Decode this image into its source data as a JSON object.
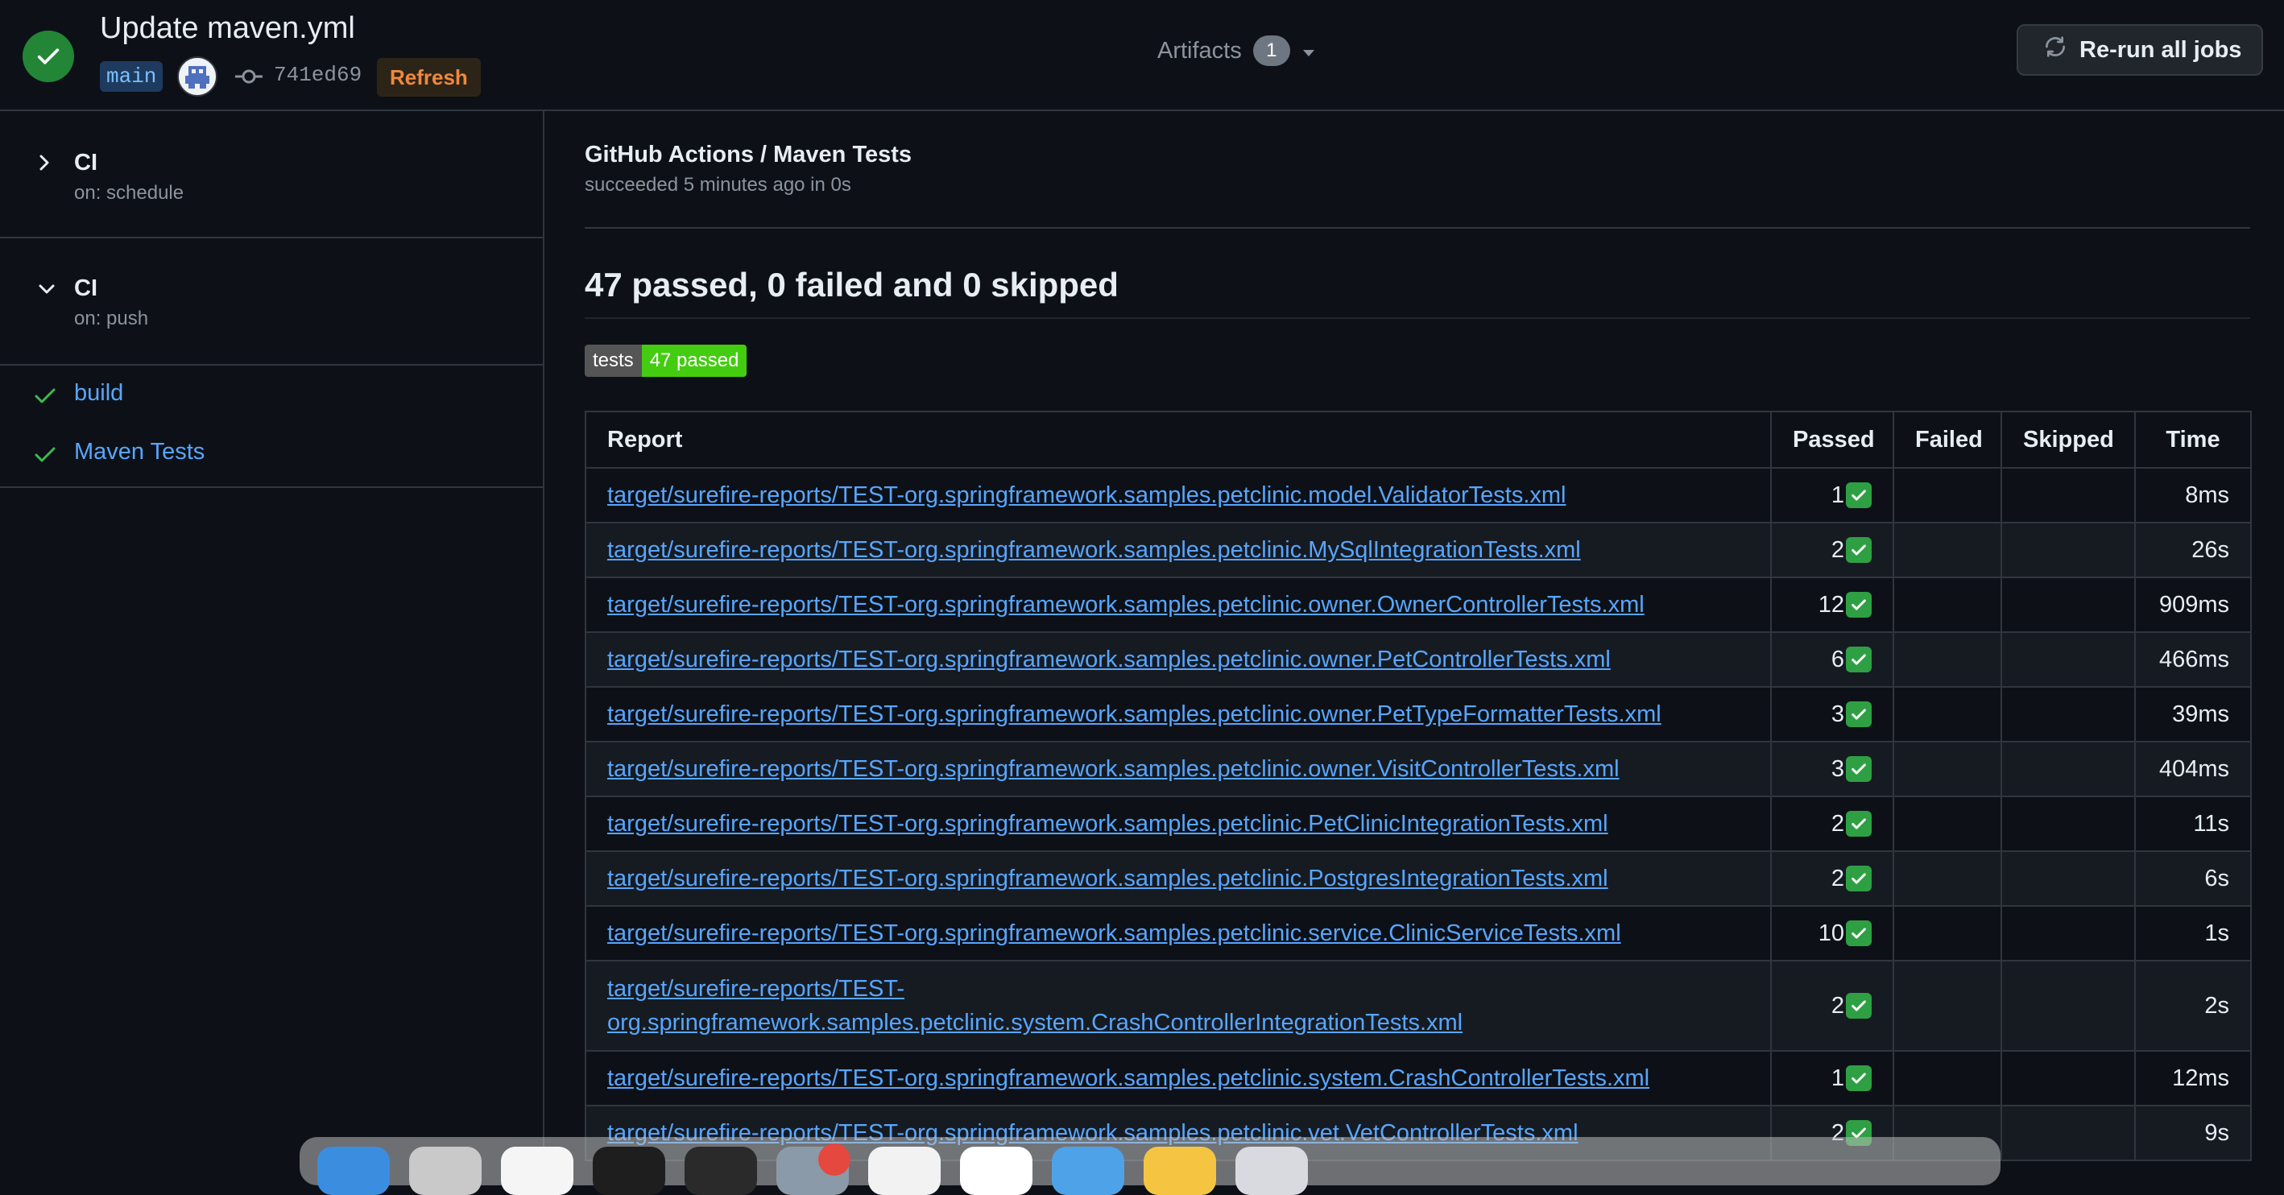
{
  "header": {
    "title": "Update maven.yml",
    "branch": "main",
    "commit_sha": "741ed69",
    "refresh_label": "Refresh",
    "artifacts_label": "Artifacts",
    "artifacts_count": "1",
    "rerun_label": "Re-run all jobs",
    "status": "success"
  },
  "sidebar": {
    "workflows": [
      {
        "name": "CI",
        "trigger": "on: schedule",
        "expanded": false
      },
      {
        "name": "CI",
        "trigger": "on: push",
        "expanded": true
      }
    ],
    "jobs": [
      {
        "name": "build",
        "status": "success"
      },
      {
        "name": "Maven Tests",
        "status": "success"
      }
    ]
  },
  "main": {
    "title": "GitHub Actions / Maven Tests",
    "subtitle": "succeeded 5 minutes ago in 0s",
    "summary": "47 passed, 0 failed and 0 skipped",
    "badge_left": "tests",
    "badge_right": "47 passed",
    "table": {
      "headers": [
        "Report",
        "Passed",
        "Failed",
        "Skipped",
        "Time"
      ],
      "rows": [
        {
          "report": "target/surefire-reports/TEST-org.springframework.samples.petclinic.model.ValidatorTests.xml",
          "passed": "1",
          "failed": "",
          "skipped": "",
          "time": "8ms"
        },
        {
          "report": "target/surefire-reports/TEST-org.springframework.samples.petclinic.MySqlIntegrationTests.xml",
          "passed": "2",
          "failed": "",
          "skipped": "",
          "time": "26s"
        },
        {
          "report": "target/surefire-reports/TEST-org.springframework.samples.petclinic.owner.OwnerControllerTests.xml",
          "passed": "12",
          "failed": "",
          "skipped": "",
          "time": "909ms"
        },
        {
          "report": "target/surefire-reports/TEST-org.springframework.samples.petclinic.owner.PetControllerTests.xml",
          "passed": "6",
          "failed": "",
          "skipped": "",
          "time": "466ms"
        },
        {
          "report": "target/surefire-reports/TEST-org.springframework.samples.petclinic.owner.PetTypeFormatterTests.xml",
          "passed": "3",
          "failed": "",
          "skipped": "",
          "time": "39ms"
        },
        {
          "report": "target/surefire-reports/TEST-org.springframework.samples.petclinic.owner.VisitControllerTests.xml",
          "passed": "3",
          "failed": "",
          "skipped": "",
          "time": "404ms"
        },
        {
          "report": "target/surefire-reports/TEST-org.springframework.samples.petclinic.PetClinicIntegrationTests.xml",
          "passed": "2",
          "failed": "",
          "skipped": "",
          "time": "11s"
        },
        {
          "report": "target/surefire-reports/TEST-org.springframework.samples.petclinic.PostgresIntegrationTests.xml",
          "passed": "2",
          "failed": "",
          "skipped": "",
          "time": "6s"
        },
        {
          "report": "target/surefire-reports/TEST-org.springframework.samples.petclinic.service.ClinicServiceTests.xml",
          "passed": "10",
          "failed": "",
          "skipped": "",
          "time": "1s"
        },
        {
          "report_line1": "target/surefire-reports/TEST-",
          "report_line2": "org.springframework.samples.petclinic.system.CrashControllerIntegrationTests.xml",
          "passed": "2",
          "failed": "",
          "skipped": "",
          "time": "2s"
        },
        {
          "report": "target/surefire-reports/TEST-org.springframework.samples.petclinic.system.CrashControllerTests.xml",
          "passed": "1",
          "failed": "",
          "skipped": "",
          "time": "12ms"
        },
        {
          "report": "target/surefire-reports/TEST-org.springframework.samples.petclinic.vet.VetControllerTests.xml",
          "passed": "2",
          "failed": "",
          "skipped": "",
          "time": "9s"
        }
      ]
    }
  },
  "colors": {
    "background": "#0d1117",
    "accent_link": "#58a6ff",
    "success": "#238636",
    "border": "#30363d"
  }
}
